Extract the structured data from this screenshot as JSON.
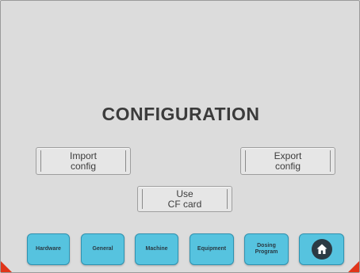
{
  "screen": {
    "title": "CONFIGURATION"
  },
  "actions": {
    "import_line1": "Import",
    "import_line2": "config",
    "export_line1": "Export",
    "export_line2": "config",
    "cfcard_line1": "Use",
    "cfcard_line2": "CF card"
  },
  "tabs": [
    {
      "label": "Hardware"
    },
    {
      "label": "General"
    },
    {
      "label": "Machine"
    },
    {
      "label": "Equipment"
    },
    {
      "label": "Dosing Program"
    }
  ],
  "home": {
    "icon": "home-icon"
  },
  "colors": {
    "background": "#dcdcdc",
    "tab_fill": "#56c3df",
    "tab_border": "#2f92b0",
    "corner_accent": "#e0351a",
    "home_icon": "#2b3a44"
  }
}
